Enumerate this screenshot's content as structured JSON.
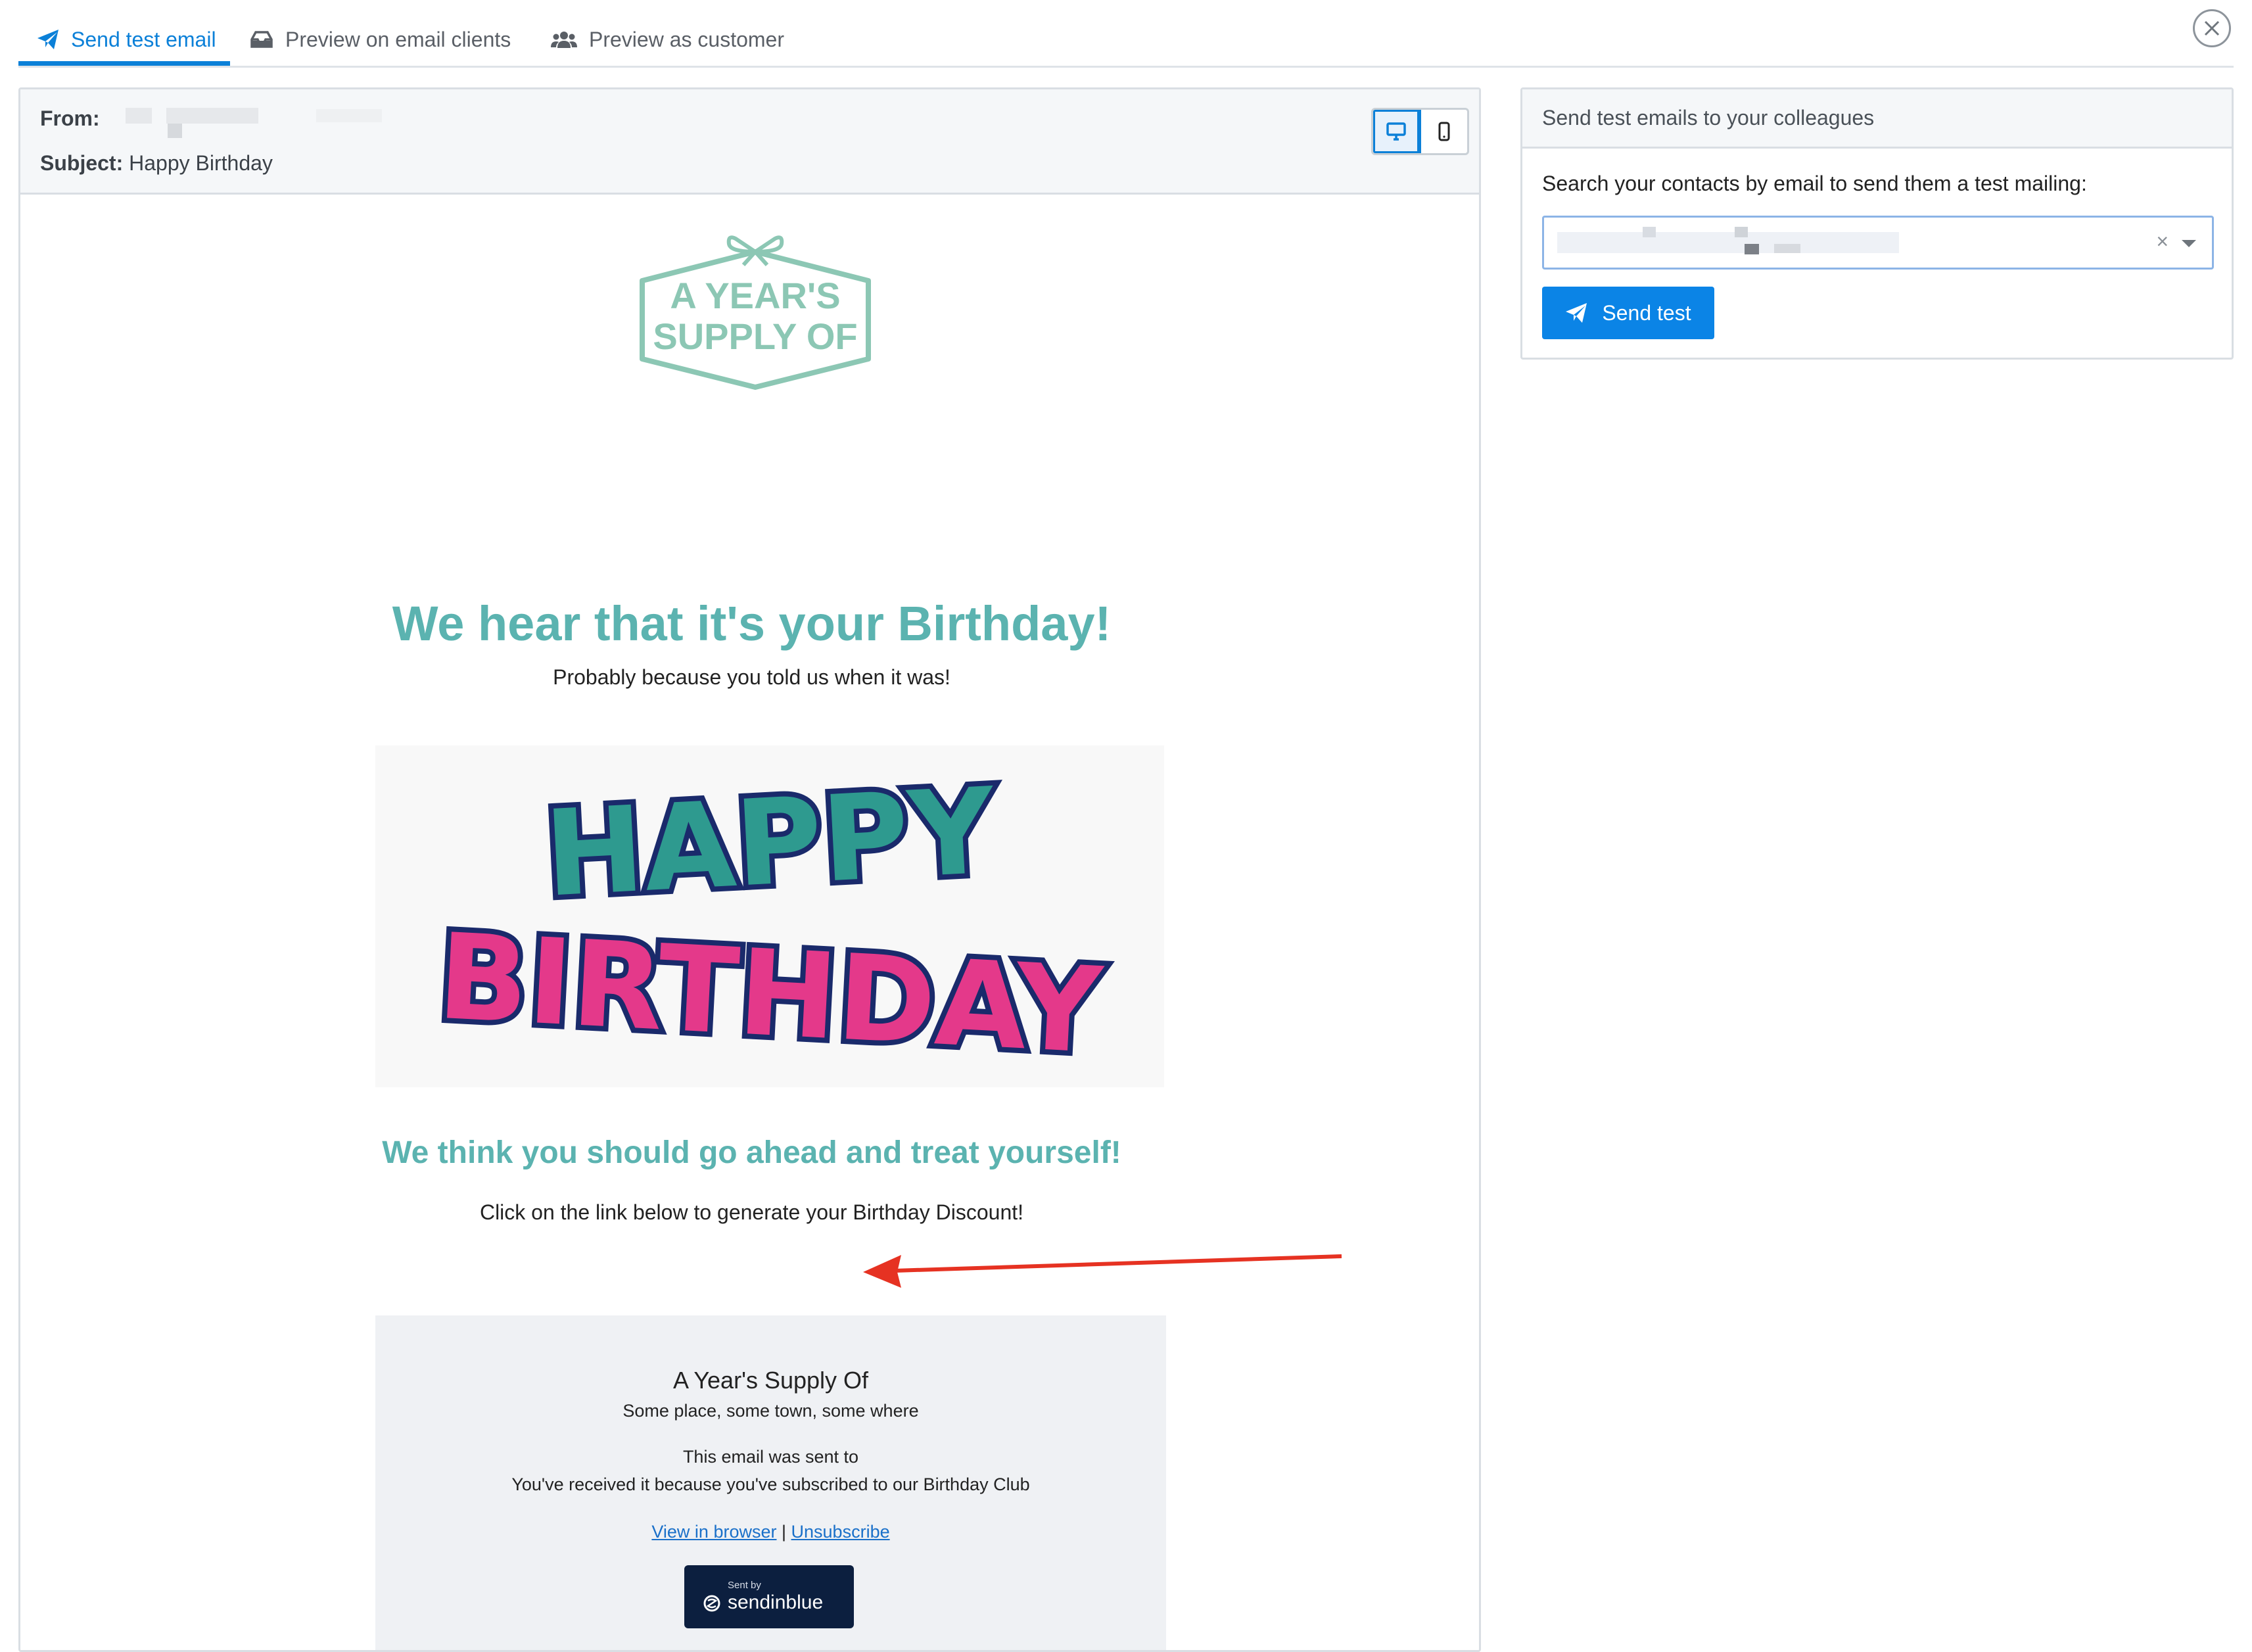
{
  "tabs": [
    {
      "label": "Send test email",
      "icon": "paper-plane-icon",
      "active": true
    },
    {
      "label": "Preview on email clients",
      "icon": "inbox-icon",
      "active": false
    },
    {
      "label": "Preview as customer",
      "icon": "users-icon",
      "active": false
    }
  ],
  "preview": {
    "from_label": "From:",
    "subject_label": "Subject:",
    "subject_value": "Happy Birthday",
    "device_modes": [
      "desktop",
      "mobile"
    ],
    "active_device": "desktop"
  },
  "email": {
    "logo_line1": "A YEAR'S",
    "logo_line2": "SUPPLY OF",
    "headline": "We hear that it's your Birthday!",
    "subheadline": "Probably because you told us when it was!",
    "banner_line1": "HAPPY",
    "banner_line2": "BIRTHDAY",
    "headline2": "We think you should go ahead and treat yourself!",
    "body": "Click on the link below to generate your Birthday Discount!"
  },
  "footer": {
    "company": "A Year's Supply Of",
    "address": "Some place, some town, some where",
    "sent_to": "This email was sent to",
    "reason": "You've received it because you've subscribed to our Birthday Club",
    "view_in_browser": "View in browser",
    "separator": "|",
    "unsubscribe": "Unsubscribe",
    "badge_small": "Sent by",
    "badge_name": "sendinblue"
  },
  "side_panel": {
    "title": "Send test emails to your colleagues",
    "search_label": "Search your contacts by email to send them a test mailing:",
    "clear_symbol": "×",
    "send_button": "Send test"
  },
  "colors": {
    "accent": "#0b80d8",
    "teal": "#5bb3b0",
    "logo_green": "#8cc7b4",
    "arrow_red": "#e63222",
    "footer_bg": "#eff1f4",
    "badge_bg": "#0c1f3f"
  }
}
